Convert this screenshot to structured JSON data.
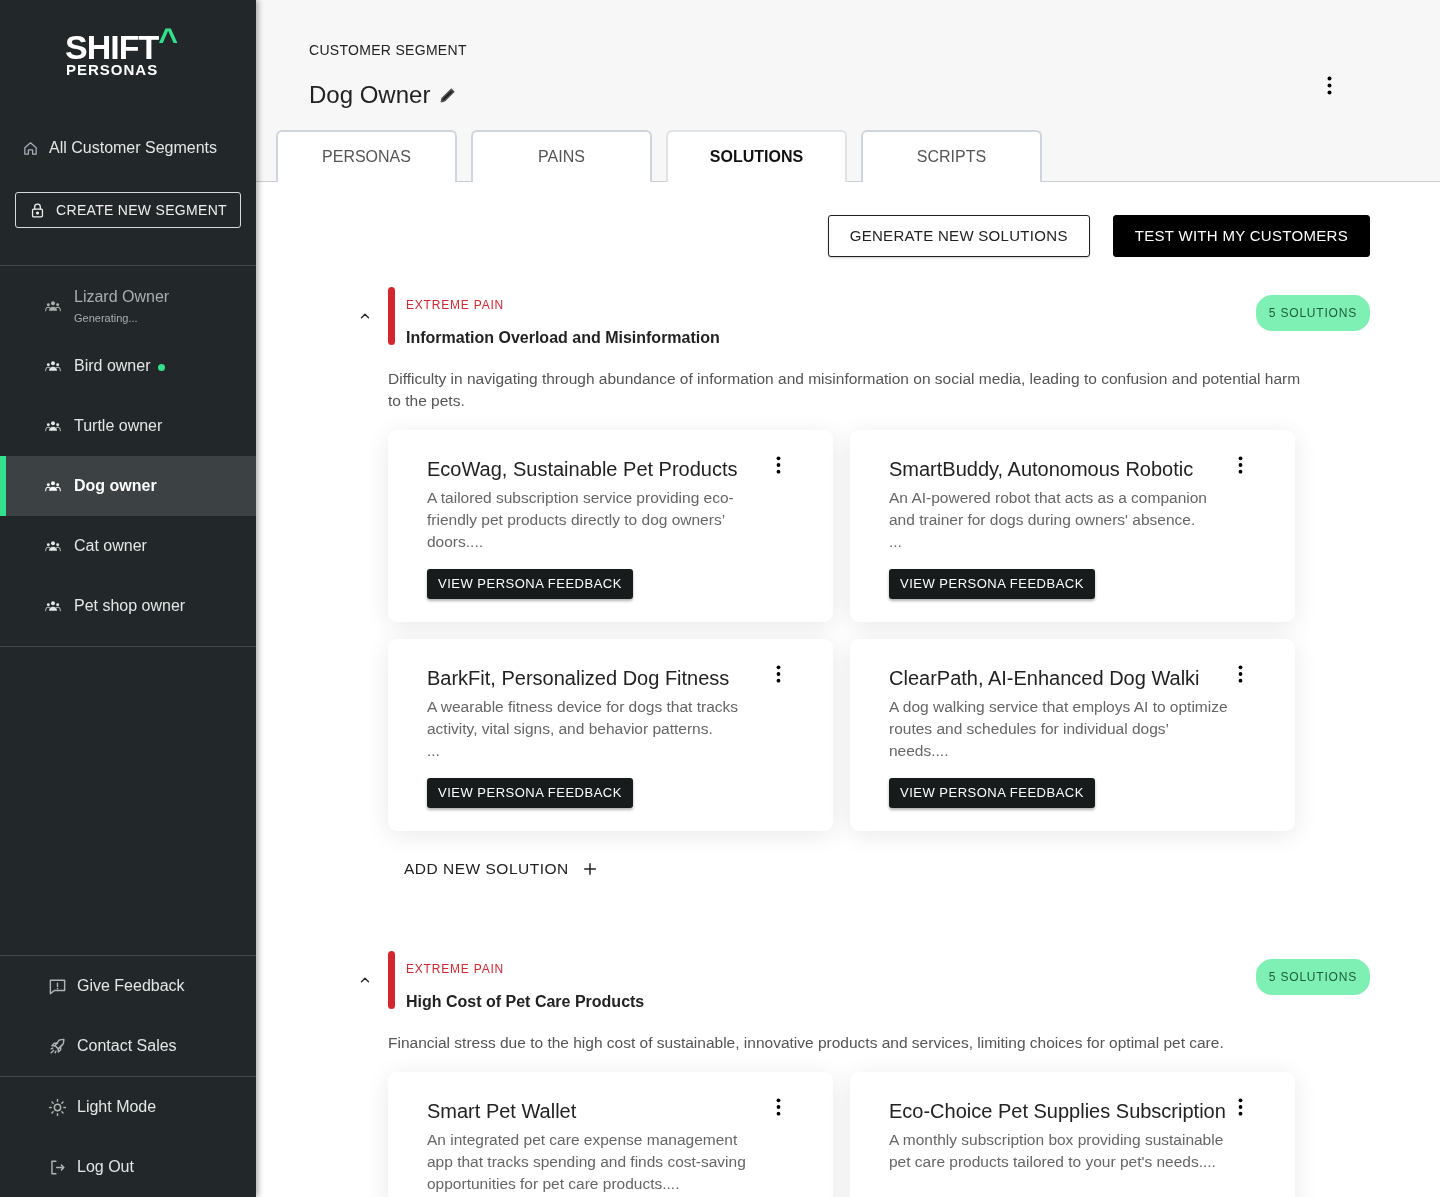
{
  "sidebar": {
    "logo": {
      "word": "SHIFT",
      "caret": "^",
      "sub": "PERSONAS"
    },
    "home_link": "All Customer Segments",
    "create_button": "CREATE NEW SEGMENT",
    "segments": [
      {
        "label": "Lizard Owner",
        "subtitle": "Generating...",
        "disabled": true,
        "unread": false,
        "selected": false
      },
      {
        "label": "Bird owner",
        "disabled": false,
        "unread": true,
        "selected": false
      },
      {
        "label": "Turtle owner",
        "disabled": false,
        "unread": false,
        "selected": false
      },
      {
        "label": "Dog owner",
        "disabled": false,
        "unread": false,
        "selected": true
      },
      {
        "label": "Cat owner",
        "disabled": false,
        "unread": false,
        "selected": false
      },
      {
        "label": "Pet shop owner",
        "disabled": false,
        "unread": false,
        "selected": false
      }
    ],
    "footer_groups": [
      [
        {
          "kind": "feedback",
          "label": "Give Feedback"
        },
        {
          "kind": "rocket",
          "label": "Contact Sales"
        }
      ],
      [
        {
          "kind": "sun",
          "label": "Light Mode"
        },
        {
          "kind": "logout",
          "label": "Log Out"
        }
      ]
    ]
  },
  "header": {
    "eyebrow": "CUSTOMER SEGMENT",
    "title": "Dog Owner"
  },
  "tabs": [
    {
      "label": "PERSONAS",
      "selected": false
    },
    {
      "label": "PAINS",
      "selected": false
    },
    {
      "label": "SOLUTIONS",
      "selected": true
    },
    {
      "label": "SCRIPTS",
      "selected": false
    }
  ],
  "actions": [
    {
      "kind": "outline",
      "label": "GENERATE NEW SOLUTIONS"
    },
    {
      "kind": "solid",
      "label": "TEST WITH MY CUSTOMERS"
    }
  ],
  "pains": [
    {
      "severity": "EXTREME PAIN",
      "title": "Information Overload and Misinformation",
      "count": "5 SOLUTIONS",
      "expanded": true,
      "description": "Difficulty in navigating through abundance of information and misinformation on social media, leading to confusion and potential harm to the pets.",
      "solutions": [
        {
          "title": "EcoWag, Sustainable Pet Products",
          "description": "A tailored subscription service providing eco-friendly pet products directly to dog owners’ doors....",
          "button": "VIEW PERSONA FEEDBACK"
        },
        {
          "title": "SmartBuddy, Autonomous Robotic",
          "description": "An AI-powered robot that acts as a companion and trainer for dogs during owners' absence.\n...",
          "button": "VIEW PERSONA FEEDBACK"
        },
        {
          "title": "BarkFit, Personalized Dog Fitness",
          "description": "A wearable fitness device for dogs that tracks activity, vital signs, and behavior patterns.\n...",
          "button": "VIEW PERSONA FEEDBACK"
        },
        {
          "title": "ClearPath, AI-Enhanced Dog Walki",
          "description": "A dog walking service that employs AI to optimize routes and schedules for individual dogs’ needs....",
          "button": "VIEW PERSONA FEEDBACK"
        }
      ],
      "add_label": "ADD NEW SOLUTION"
    },
    {
      "severity": "EXTREME PAIN",
      "title": "High Cost of Pet Care Products",
      "count": "5 SOLUTIONS",
      "expanded": true,
      "description": "Financial stress due to the high cost of sustainable, innovative products and services, limiting choices for optimal pet care.",
      "solutions": [
        {
          "title": "Smart Pet Wallet",
          "description": "An integrated pet care expense management app that tracks spending and finds cost-saving opportunities for pet care products...."
        },
        {
          "title": "Eco-Choice Pet Supplies Subscription",
          "description": "A monthly subscription box providing sustainable pet care products tailored to your pet's needs...."
        }
      ]
    }
  ]
}
